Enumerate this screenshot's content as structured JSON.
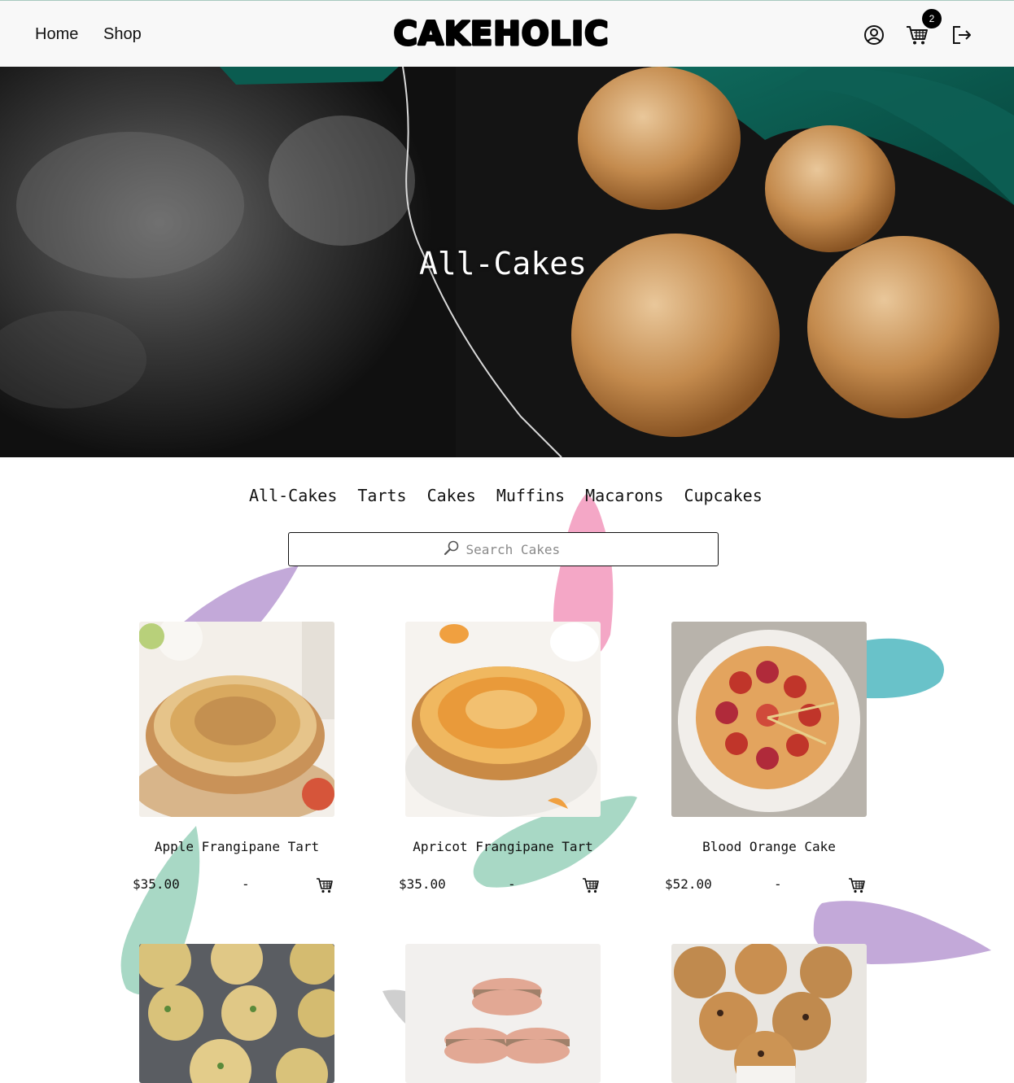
{
  "header": {
    "nav": [
      {
        "label": "Home"
      },
      {
        "label": "Shop"
      }
    ],
    "logo_text": "CAKEHOLIC",
    "cart_count": "2",
    "icons": [
      "user-circle-icon",
      "cart-icon",
      "logout-icon"
    ]
  },
  "hero": {
    "title": "All-Cakes"
  },
  "categories": [
    "All-Cakes",
    "Tarts",
    "Cakes",
    "Muffins",
    "Macarons",
    "Cupcakes"
  ],
  "search": {
    "placeholder": "Search Cakes",
    "value": "",
    "icon": "magnifier-icon"
  },
  "products": [
    {
      "name": "Apple Frangipane Tart",
      "price": "$35.00",
      "dash": "-"
    },
    {
      "name": "Apricot Frangipane Tart",
      "price": "$35.00",
      "dash": "-"
    },
    {
      "name": "Blood Orange Cake",
      "price": "$52.00",
      "dash": "-"
    },
    {
      "name": "",
      "price": "",
      "dash": ""
    },
    {
      "name": "",
      "price": "",
      "dash": ""
    },
    {
      "name": "",
      "price": "",
      "dash": ""
    }
  ],
  "colors": {
    "header_bg": "#f8f8f8",
    "blob_purple": "#c3a9d9",
    "blob_pink": "#f4a7c6",
    "blob_teal": "#69c2c9",
    "blob_mint": "#a8d8c5"
  }
}
